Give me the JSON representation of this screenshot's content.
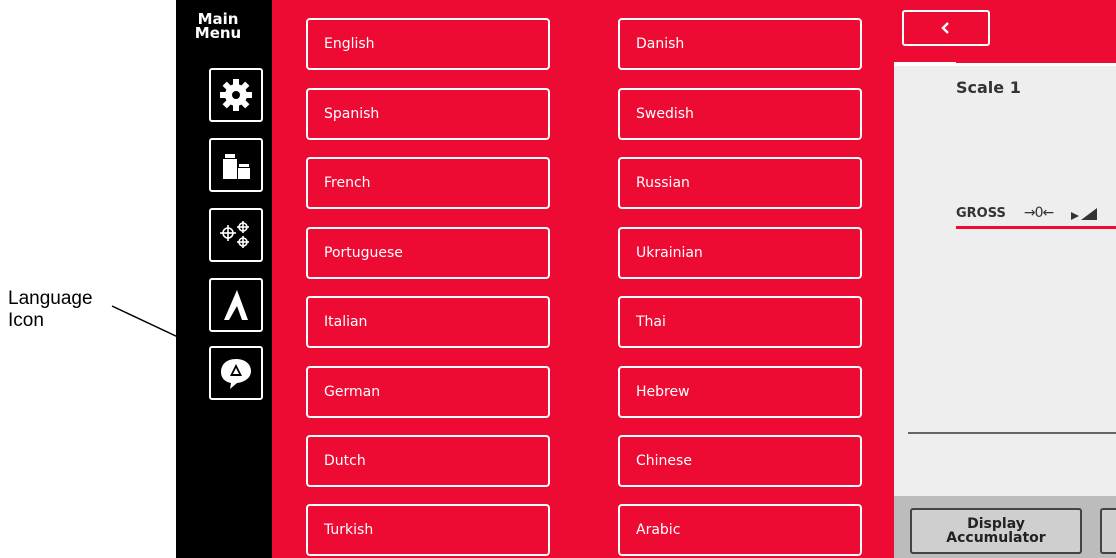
{
  "callout": {
    "line1": "Language",
    "line2": "Icon"
  },
  "sidebar": {
    "title_line1": "Main",
    "title_line2": "Menu",
    "items": [
      {
        "icon": "gear-icon"
      },
      {
        "icon": "weights-icon"
      },
      {
        "icon": "crosshairs-icon"
      },
      {
        "icon": "ramp-icon"
      },
      {
        "icon": "language-icon"
      }
    ]
  },
  "languages": {
    "left": [
      "English",
      "Spanish",
      "French",
      "Portuguese",
      "Italian",
      "German",
      "Dutch",
      "Turkish"
    ],
    "right": [
      "Danish",
      "Swedish",
      "Russian",
      "Ukrainian",
      "Thai",
      "Hebrew",
      "Chinese",
      "Arabic"
    ]
  },
  "right_panel": {
    "back_icon": "chevron-left-icon",
    "scale_label": "Scale 1",
    "gross_label": "GROSS",
    "zero_symbol": "→0←",
    "display_accumulator_line1": "Display",
    "display_accumulator_line2": "Accumulator"
  },
  "colors": {
    "accent": "#ed0a33",
    "sidebar_bg": "#000000"
  }
}
